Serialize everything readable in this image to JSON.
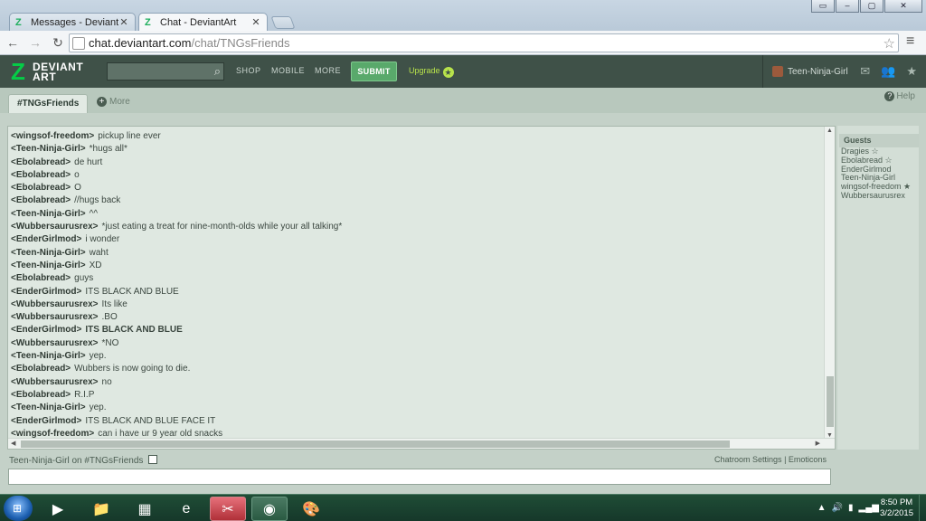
{
  "browser": {
    "tabs": [
      {
        "title": "Messages - DeviantArt",
        "active": false
      },
      {
        "title": "Chat - DeviantArt",
        "active": true
      }
    ],
    "url_host": "chat.deviantart.com",
    "url_path": "/chat/TNGsFriends"
  },
  "header": {
    "logo_line1": "DEVIANT",
    "logo_line2": "ART",
    "search_placeholder": "",
    "nav": [
      "SHOP",
      "MOBILE",
      "MORE"
    ],
    "submit_label": "SUBMIT",
    "upgrade_label": "Upgrade",
    "username": "Teen-Ninja-Girl"
  },
  "room": {
    "tab_label": "#TNGsFriends",
    "more_label": "More",
    "help_label": "Help"
  },
  "messages": [
    {
      "user": "<wingsof-freedom>",
      "text": "pickup line ever",
      "bold": false
    },
    {
      "user": "<Teen-Ninja-Girl>",
      "text": "*hugs all*",
      "bold": false
    },
    {
      "user": "<Ebolabread>",
      "text": "de hurt",
      "bold": false
    },
    {
      "user": "<Ebolabread>",
      "text": "o",
      "bold": false
    },
    {
      "user": "<Ebolabread>",
      "text": "O",
      "bold": false
    },
    {
      "user": "<Ebolabread>",
      "text": "//hugs back",
      "bold": false
    },
    {
      "user": "<Teen-Ninja-Girl>",
      "text": "^^",
      "bold": false
    },
    {
      "user": "<Wubbersaurusrex>",
      "text": "*just eating a treat for nine-month-olds while your all talking*",
      "bold": false
    },
    {
      "user": "<EnderGirlmod>",
      "text": "i wonder",
      "bold": false
    },
    {
      "user": "<Teen-Ninja-Girl>",
      "text": "waht",
      "bold": false
    },
    {
      "user": "<Teen-Ninja-Girl>",
      "text": "XD",
      "bold": false
    },
    {
      "user": "<Ebolabread>",
      "text": "guys",
      "bold": false
    },
    {
      "user": "<EnderGirlmod>",
      "text": "ITS BLACK AND BLUE",
      "bold": false
    },
    {
      "user": "<Wubbersaurusrex>",
      "text": "Its like",
      "bold": false
    },
    {
      "user": "<Wubbersaurusrex>",
      "text": ".BO",
      "bold": false
    },
    {
      "user": "<EnderGirlmod>",
      "text": "ITS BLACK AND BLUE",
      "bold": true
    },
    {
      "user": "<Wubbersaurusrex>",
      "text": "*NO",
      "bold": false
    },
    {
      "user": "<Teen-Ninja-Girl>",
      "text": "yep.",
      "bold": false
    },
    {
      "user": "<Ebolabread>",
      "text": "Wubbers is now going to die.",
      "bold": false
    },
    {
      "user": "<Wubbersaurusrex>",
      "text": "no",
      "bold": false
    },
    {
      "user": "<Ebolabread>",
      "text": "R.I.P",
      "bold": false
    },
    {
      "user": "<Teen-Ninja-Girl>",
      "text": "yep.",
      "bold": false
    },
    {
      "user": "<EnderGirlmod>",
      "text": "ITS BLACK AND BLUE FACE IT",
      "bold": false
    },
    {
      "user": "<wingsof-freedom>",
      "text": "can i have ur 9 year old snacks",
      "bold": false
    }
  ],
  "userlist": {
    "heading": "Guests",
    "users": [
      "Dragies ☆",
      "Ebolabread ☆",
      "EnderGirlmod",
      "Teen-Ninja-Girl",
      "wingsof-freedom ★",
      "Wubbersaurusrex"
    ]
  },
  "footer": {
    "status": "Teen-Ninja-Girl on #TNGsFriends",
    "settings_label": "Chatroom Settings",
    "separator": "|",
    "emoticons_label": "Emoticons"
  },
  "taskbar": {
    "time": "8:50 PM",
    "date": "3/2/2015"
  },
  "colors": {
    "da_header": "#3f5148",
    "da_green": "#05cc47",
    "submit": "#59a96b",
    "chat_panel": "#dfe8e1"
  }
}
